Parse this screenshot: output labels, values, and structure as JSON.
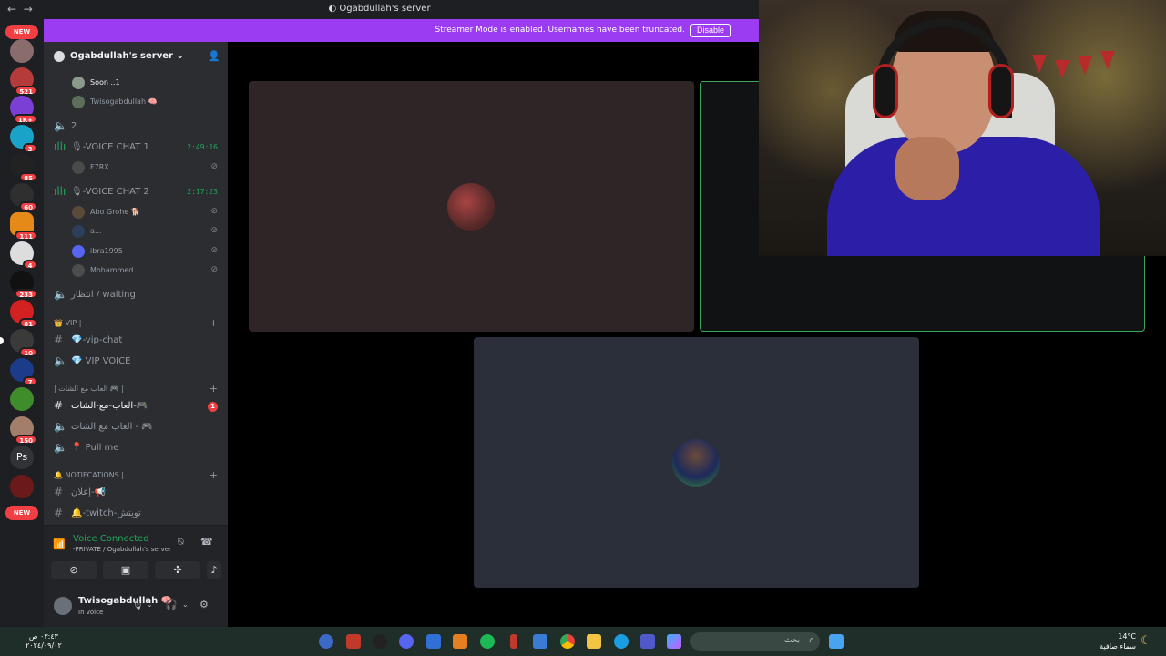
{
  "window": {
    "title": "Ogabdullah's server",
    "back": "←",
    "forward": "→"
  },
  "banner": {
    "message": "Streamer Mode is enabled. Usernames have been truncated.",
    "button": "Disable"
  },
  "server_rail": {
    "new_top": "NEW",
    "new_bottom": "NEW",
    "badges": [
      "521",
      "1K+",
      "3",
      "85",
      "60",
      "111",
      "4",
      "233",
      "81",
      "10",
      "7",
      "150"
    ],
    "ps_label": "Ps"
  },
  "server": {
    "name": "Ogabdullah's server",
    "chevron": "⌄"
  },
  "channels": {
    "top_users": [
      {
        "name": "Soon ..1"
      },
      {
        "name": "Twisogabdullah 🧠"
      }
    ],
    "voice2": {
      "label": "2"
    },
    "vc1": {
      "label": "🎙-VOICE CHAT 1",
      "timer": "2:49:16",
      "users": [
        {
          "name": "F7RX"
        }
      ]
    },
    "vc2": {
      "label": "🎙-VOICE CHAT 2",
      "timer": "2:17:23",
      "users": [
        {
          "name": "Abo Grohe 🐕"
        },
        {
          "name": "a..."
        },
        {
          "name": "ibra1995"
        },
        {
          "name": "Mohammed"
        }
      ]
    },
    "waiting": "انتظار / waiting",
    "cat_vip": "👑 VIP |",
    "vip_chat": "💎-vip-chat",
    "vip_voice": "💎 VIP VOICE",
    "cat_games": "| العاب مع الشات 🎮 |",
    "games_chat": "العاب-مع-الشات-🎮",
    "games_unread": "1",
    "games_voice": "العاب مع الشات - 🎮",
    "pull_me": "📍 Pull me",
    "cat_notif": "🔔 NOTIFCATIONS |",
    "ads": "إعلان-📢",
    "twitch": "🔔-twitch-تويتش"
  },
  "voice_panel": {
    "status": "Voice Connected",
    "channel": "-PRIVATE / Ogabdullah's server"
  },
  "user_panel": {
    "name": "Twisogabdullah 🧠",
    "status": "In voice"
  },
  "taskbar": {
    "time": "٠٣:٤٣ ص",
    "date": "٢٠٢٤/٠٩/٠٢",
    "search_placeholder": "بحث",
    "temperature": "14°C",
    "weather": "سماء صافية"
  },
  "colors": {
    "banner": "#9b3cf2",
    "voice_green": "#23a55a",
    "badge_red": "#f23f43",
    "sidebar": "#2b2d31",
    "tile_active_border": "#3ba55c"
  }
}
